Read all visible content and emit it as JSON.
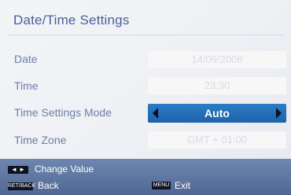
{
  "screen": {
    "title": "Date/Time Settings"
  },
  "rows": {
    "date": {
      "label": "Date",
      "value": "14/09/2008"
    },
    "time": {
      "label": "Time",
      "value": "23:30"
    },
    "mode": {
      "label": "Time Settings Mode",
      "value": "Auto"
    },
    "zone": {
      "label": "Time Zone",
      "value": "GMT + 01:00"
    }
  },
  "footer": {
    "change_value": "Change Value",
    "back_key": "RET/BACK",
    "back_label": "Back",
    "menu_key": "MENU",
    "exit_label": "Exit"
  },
  "colors": {
    "accent": "#1e63aa",
    "title_text": "#4a5f9a",
    "label_text": "#6d7ea8",
    "footer_bg": "#5f78a2"
  }
}
